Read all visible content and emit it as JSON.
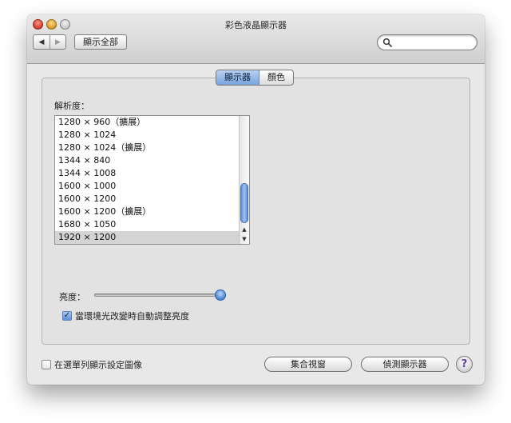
{
  "window": {
    "title": "彩色液晶顯示器"
  },
  "toolbar": {
    "back_icon": "back-arrow-icon",
    "forward_icon": "forward-arrow-icon",
    "show_all_label": "顯示全部",
    "search_placeholder": "",
    "search_value": ""
  },
  "tabs": [
    {
      "label": "顯示器",
      "selected": true
    },
    {
      "label": "顏色",
      "selected": false
    }
  ],
  "resolution": {
    "label": "解析度：",
    "items": [
      "1280 × 960（擴展）",
      "1280 × 1024",
      "1280 × 1024（擴展）",
      "1344 × 840",
      "1344 × 1008",
      "1600 × 1000",
      "1600 × 1200",
      "1600 × 1200（擴展）",
      "1680 × 1050",
      "1920 × 1200"
    ],
    "selected_index": 9
  },
  "brightness": {
    "label": "亮度：",
    "value": 0.96
  },
  "auto_brightness": {
    "label": "當環境光改變時自動調整亮度",
    "checked": true
  },
  "footer": {
    "menubar_checkbox_label": "在選單列顯示設定圖像",
    "menubar_checked": false,
    "gather_windows_label": "集合視窗",
    "detect_displays_label": "偵測顯示器",
    "help_label": "?"
  },
  "colors": {
    "accent": "#5f8ed8",
    "selected_row": "#d4d4d4"
  }
}
